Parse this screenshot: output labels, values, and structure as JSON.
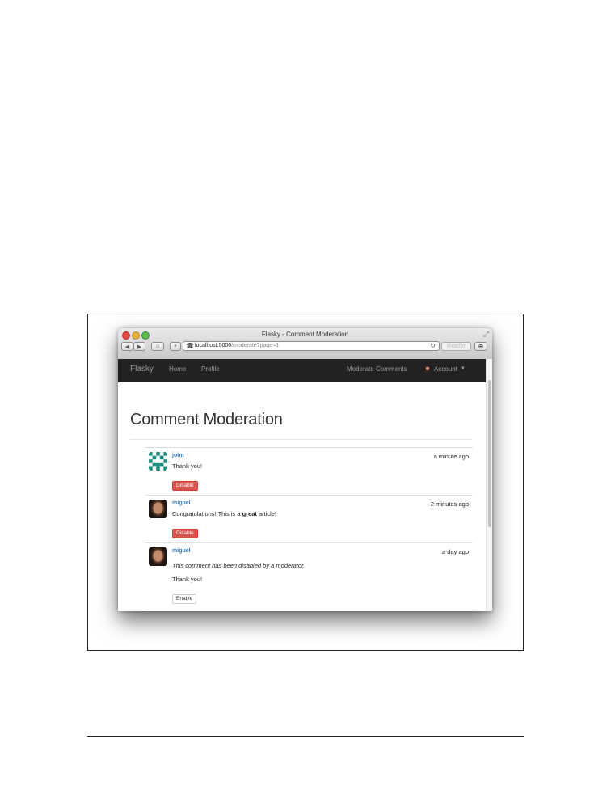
{
  "browser": {
    "window_title": "Flasky - Comment Moderation",
    "url_host": "localhost:5000",
    "url_path": "/moderate?page=1",
    "reader_label": "Reader",
    "back_icon": "◀",
    "forward_icon": "▶",
    "home_icon": "⌂",
    "add_icon": "+",
    "reload_icon": "↻",
    "download_icon": "⊕"
  },
  "navbar": {
    "brand": "Flasky",
    "home": "Home",
    "profile": "Profile",
    "moderate": "Moderate Comments",
    "account": "Account",
    "caret": "▼"
  },
  "page": {
    "title": "Comment Moderation"
  },
  "comments": [
    {
      "author": "john",
      "date": "a minute ago",
      "body": "Thank you!",
      "action": "Disable"
    },
    {
      "author": "miguel",
      "date": "2 minutes ago",
      "body_pre": "Congratulations! This is a ",
      "body_bold": "great",
      "body_post": " article!",
      "action": "Disable"
    },
    {
      "author": "miguel",
      "date": "a day ago",
      "disabled_note": "This comment has been disabled by a moderator.",
      "body": "Thank you!",
      "action": "Enable"
    }
  ],
  "colors": {
    "navbar_bg": "#222222",
    "link": "#337ab7",
    "danger": "#d9534f",
    "identicon": "#1a8a7a"
  }
}
